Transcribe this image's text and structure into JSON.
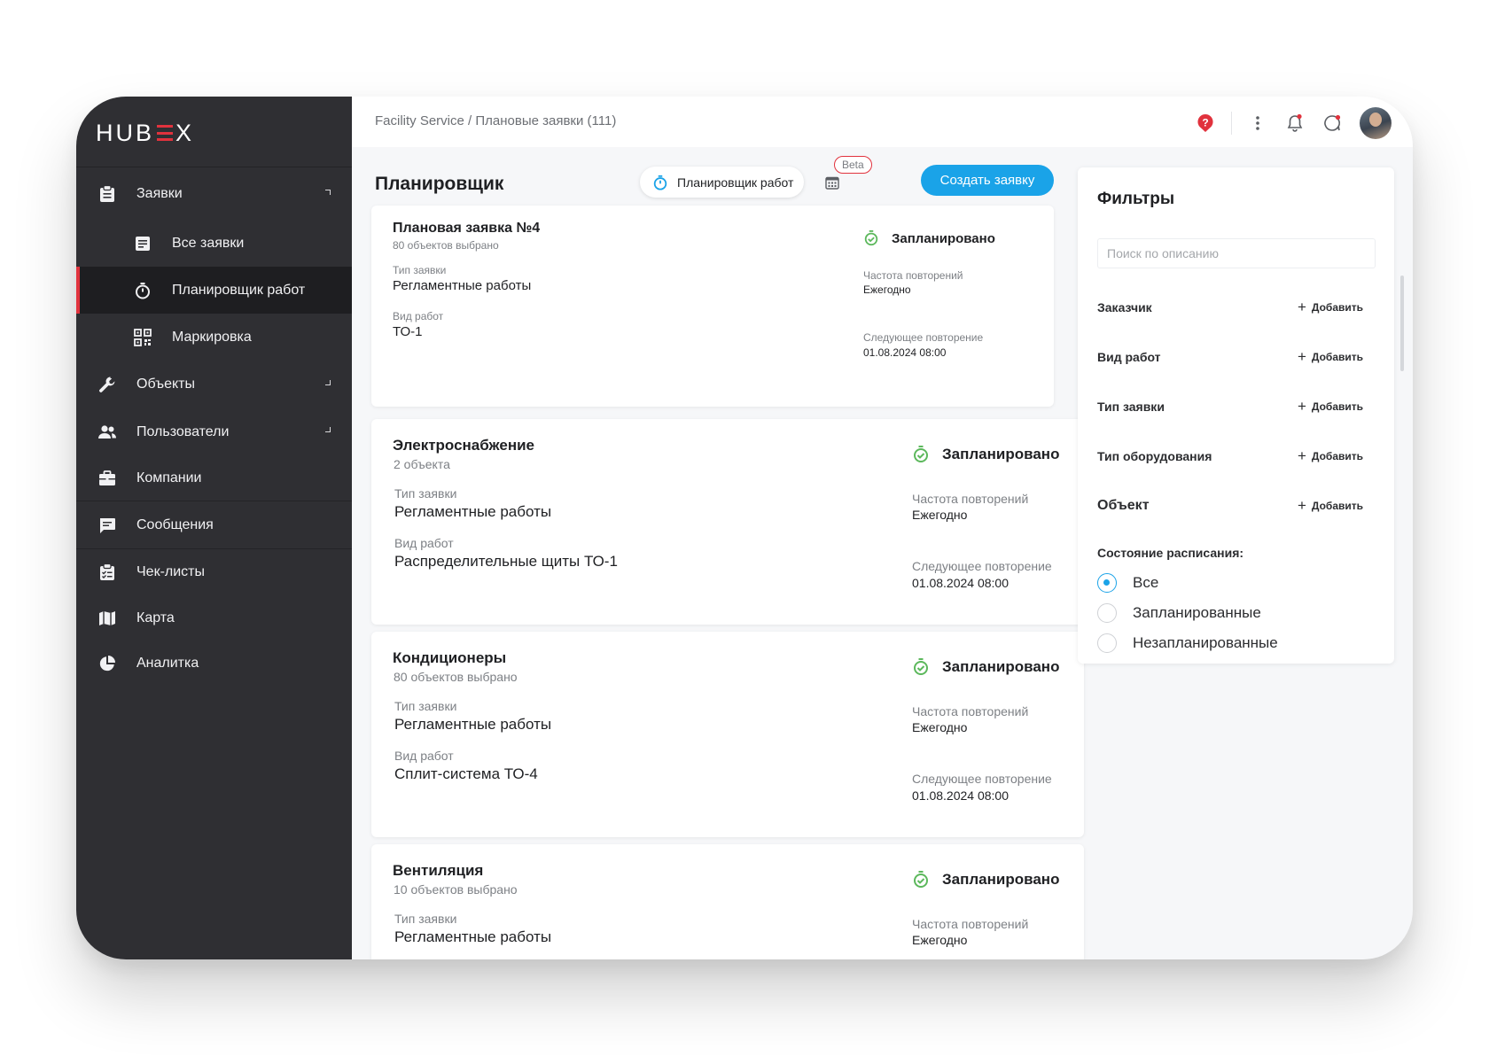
{
  "brand": {
    "logo_left": "HUB",
    "logo_right": "X"
  },
  "sidebar": {
    "items": [
      {
        "label": "Заявки"
      },
      {
        "label": "Все заявки"
      },
      {
        "label": "Планировщик работ"
      },
      {
        "label": "Маркировка"
      },
      {
        "label": "Объекты"
      },
      {
        "label": "Пользователи"
      },
      {
        "label": "Компании"
      },
      {
        "label": "Сообщения"
      },
      {
        "label": "Чек-листы"
      },
      {
        "label": "Карта"
      },
      {
        "label": "Аналитка"
      }
    ]
  },
  "header": {
    "breadcrumb": "Facility Service / Плановые заявки (111)"
  },
  "main": {
    "title": "Планировщик",
    "scheduler_pill": "Планировщик работ",
    "beta_badge": "Beta",
    "create_button": "Создать заявку",
    "cards": [
      {
        "title": "Плановая заявка №4",
        "subtitle": "80 объектов выбрано",
        "status": "Запланировано",
        "type_label": "Тип заявки",
        "type_value": "Регламентные работы",
        "work_label": "Вид работ",
        "work_value": "ТО-1",
        "freq_label": "Частота повторений",
        "freq_value": "Ежегодно",
        "next_label": "Следующее повторение",
        "next_value": "01.08.2024 08:00"
      },
      {
        "title": "Электроснабжение",
        "subtitle": "2 объекта",
        "status": "Запланировано",
        "type_label": "Тип заявки",
        "type_value": "Регламентные работы",
        "work_label": "Вид работ",
        "work_value": "Распределительные щиты ТО-1",
        "freq_label": "Частота повторений",
        "freq_value": "Ежегодно",
        "next_label": "Следующее повторение",
        "next_value": "01.08.2024 08:00"
      },
      {
        "title": "Кондиционеры",
        "subtitle": "80 объектов выбрано",
        "status": "Запланировано",
        "type_label": "Тип заявки",
        "type_value": "Регламентные работы",
        "work_label": "Вид работ",
        "work_value": "Сплит-система ТО-4",
        "freq_label": "Частота повторений",
        "freq_value": "Ежегодно",
        "next_label": "Следующее повторение",
        "next_value": "01.08.2024 08:00"
      },
      {
        "title": "Вентиляция",
        "subtitle": "10 объектов выбрано",
        "status": "Запланировано",
        "type_label": "Тип заявки",
        "type_value": "Регламентные работы",
        "freq_label": "Частота повторений",
        "freq_value": "Ежегодно"
      }
    ]
  },
  "filters": {
    "title": "Фильтры",
    "search_placeholder": "Поиск по описанию",
    "add_label": "Добавить",
    "rows": [
      "Заказчик",
      "Вид работ",
      "Тип заявки",
      "Тип оборудования",
      "Объект"
    ],
    "schedule_title": "Состояние расписания:",
    "schedule_options": [
      "Все",
      "Запланированные",
      "Незапланированные"
    ],
    "schedule_selected": "Все"
  },
  "colors": {
    "accent": "#1aa3e8",
    "brand_red": "#e1323d",
    "status_green": "#5cb85c",
    "sidebar_bg": "#2f2f33"
  }
}
